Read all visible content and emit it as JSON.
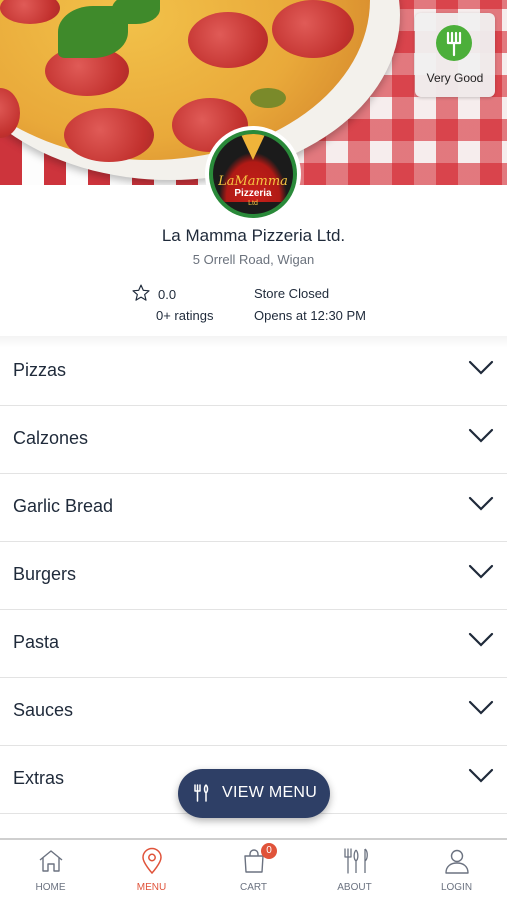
{
  "restaurant": {
    "name": "La Mamma Pizzeria Ltd.",
    "address": "5 Orrell Road, Wigan",
    "rating": "0.0",
    "ratings_count": "0+ ratings",
    "status": "Store Closed",
    "opens": "Opens at 12:30 PM",
    "hygiene_label": "Very Good",
    "logo_text": [
      "LaMamma",
      "Pizzeria",
      "Ltd"
    ]
  },
  "categories": [
    "Pizzas",
    "Calzones",
    "Garlic Bread",
    "Burgers",
    "Pasta",
    "Sauces",
    "Extras"
  ],
  "view_menu_label": "VIEW MENU",
  "tabs": [
    {
      "label": "HOME",
      "icon": "home-icon"
    },
    {
      "label": "MENU",
      "icon": "location-pin-icon",
      "active": true
    },
    {
      "label": "CART",
      "icon": "shopping-bag-icon",
      "badge": "0"
    },
    {
      "label": "ABOUT",
      "icon": "cutlery-icon"
    },
    {
      "label": "LOGIN",
      "icon": "user-icon"
    }
  ],
  "colors": {
    "accent": "#e0533a",
    "fab": "#2e3f66",
    "text": "#1f2a3a",
    "hygiene": "#4caf3a"
  }
}
